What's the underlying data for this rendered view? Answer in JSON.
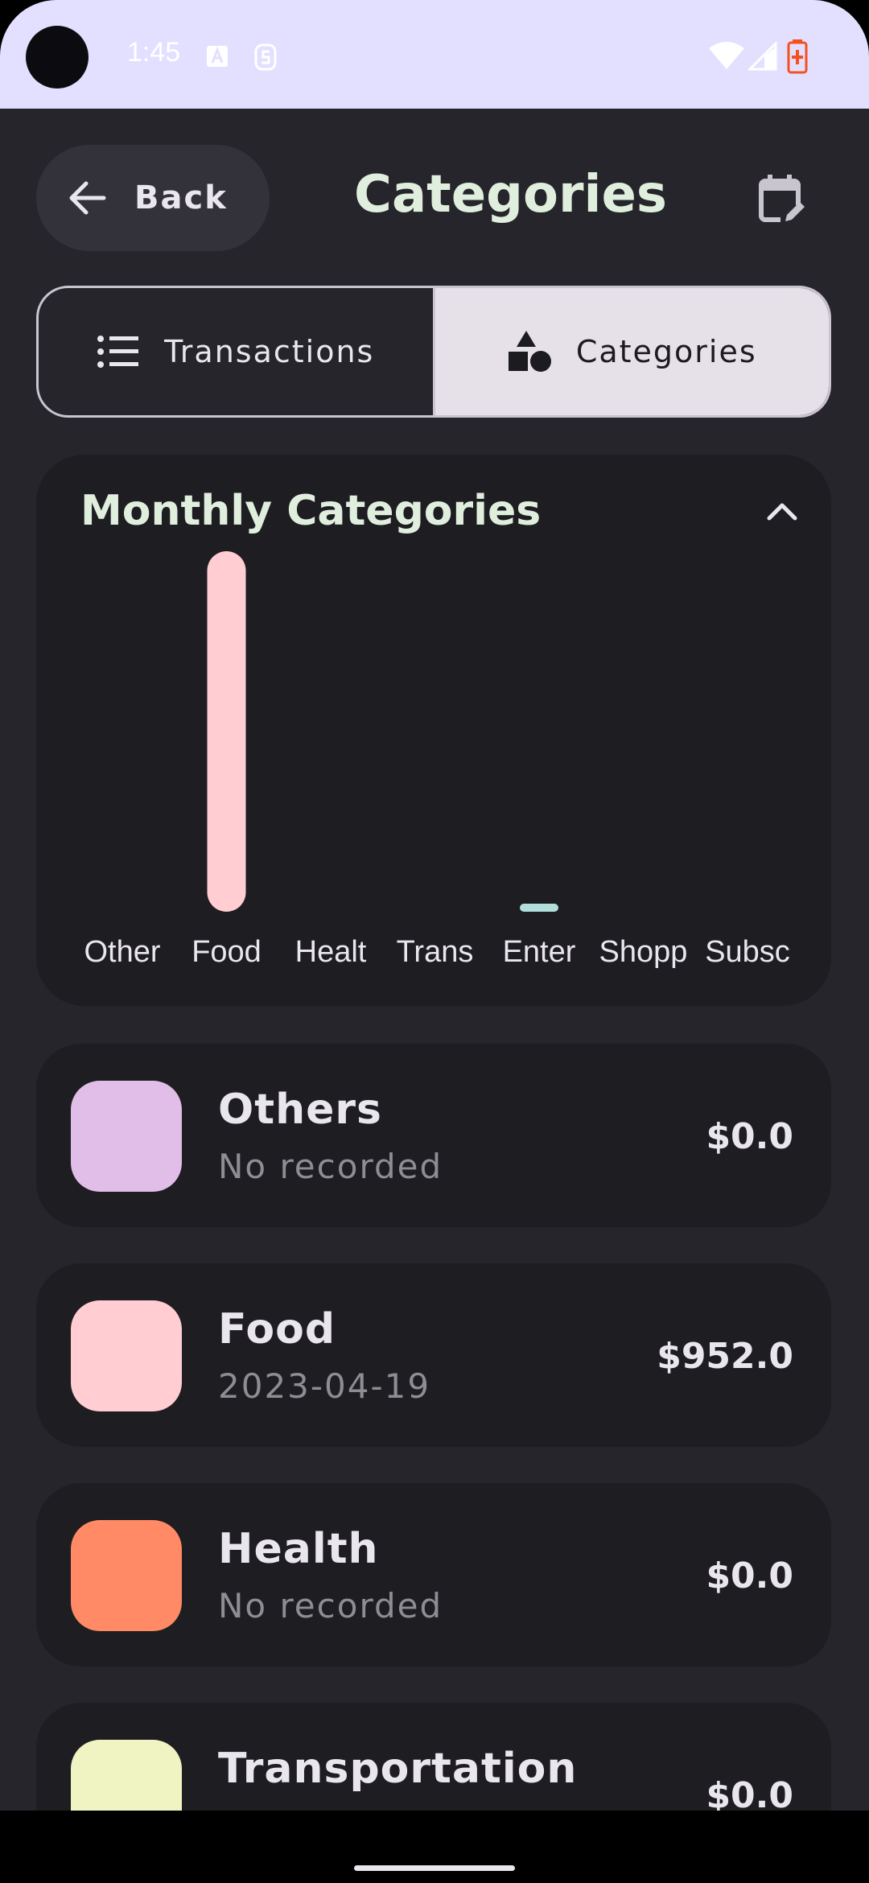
{
  "status_bar": {
    "time": "1:45"
  },
  "header": {
    "back_label": "Back",
    "title": "Categories"
  },
  "segmented": {
    "left_label": "Transactions",
    "right_label": "Categories",
    "selected": "Categories"
  },
  "chart_card": {
    "title": "Monthly Categories"
  },
  "chart_data": {
    "type": "bar",
    "title": "Monthly Categories",
    "categories": [
      "Other",
      "Food",
      "Healt",
      "Trans",
      "Enter",
      "Shopp",
      "Subsc"
    ],
    "values": [
      0,
      952,
      0,
      0,
      15,
      0,
      0
    ],
    "colors": [
      "#e1bee7",
      "#ffcdd2",
      "#ff8a65",
      "#f0f4c3",
      "#b2dfdb",
      "#bbdefb",
      "#d1c4e9"
    ],
    "ylim": [
      0,
      952
    ],
    "grid": false
  },
  "categories_list": [
    {
      "name": "Others",
      "subtitle": "No recorded",
      "amount": "$0.0",
      "color": "#e1bee7"
    },
    {
      "name": "Food",
      "subtitle": "2023-04-19",
      "amount": "$952.0",
      "color": "#ffcdd2"
    },
    {
      "name": "Health",
      "subtitle": "No recorded",
      "amount": "$0.0",
      "color": "#ff8a65"
    },
    {
      "name": "Transportation",
      "subtitle": "",
      "amount": "$0.0",
      "color": "#f0f4c3"
    }
  ],
  "icons": {
    "back": "arrow-left-icon",
    "calendar": "calendar-edit-icon",
    "transactions": "list-icon",
    "categories": "shapes-icon",
    "collapse": "chevron-up-icon"
  }
}
